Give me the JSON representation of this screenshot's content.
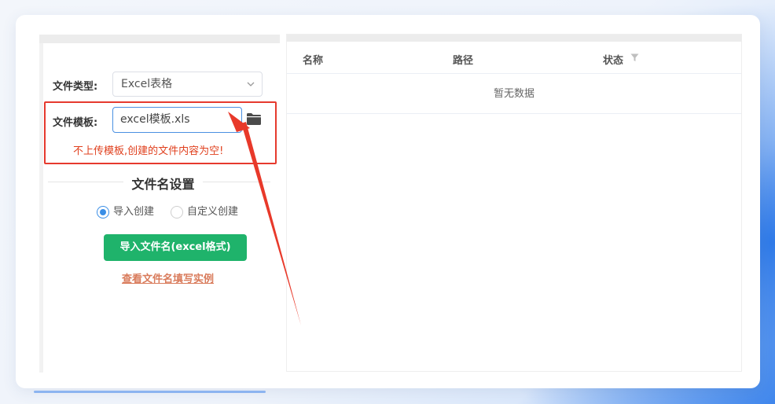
{
  "form": {
    "file_type_label": "文件类型:",
    "file_type_value": "Excel表格",
    "template_label": "文件模板:",
    "template_value": "excel模板.xls",
    "warning": "不上传模板,创建的文件内容为空!"
  },
  "filename_settings": {
    "title": "文件名设置",
    "radio_import": "导入创建",
    "radio_custom": "自定义创建",
    "selected": "导入创建",
    "import_button": "导入文件名(excel格式)",
    "example_link": "查看文件名填写实例"
  },
  "table": {
    "columns": [
      "名称",
      "路径",
      "状态"
    ],
    "empty_text": "暂无数据"
  },
  "colors": {
    "accent_green": "#1fb36b",
    "highlight_red": "#e63a2e",
    "link_orange": "#d97b5b",
    "radio_blue": "#3a8ee6"
  },
  "icons": [
    "chevron-down-icon",
    "folder-icon",
    "filter-icon"
  ]
}
